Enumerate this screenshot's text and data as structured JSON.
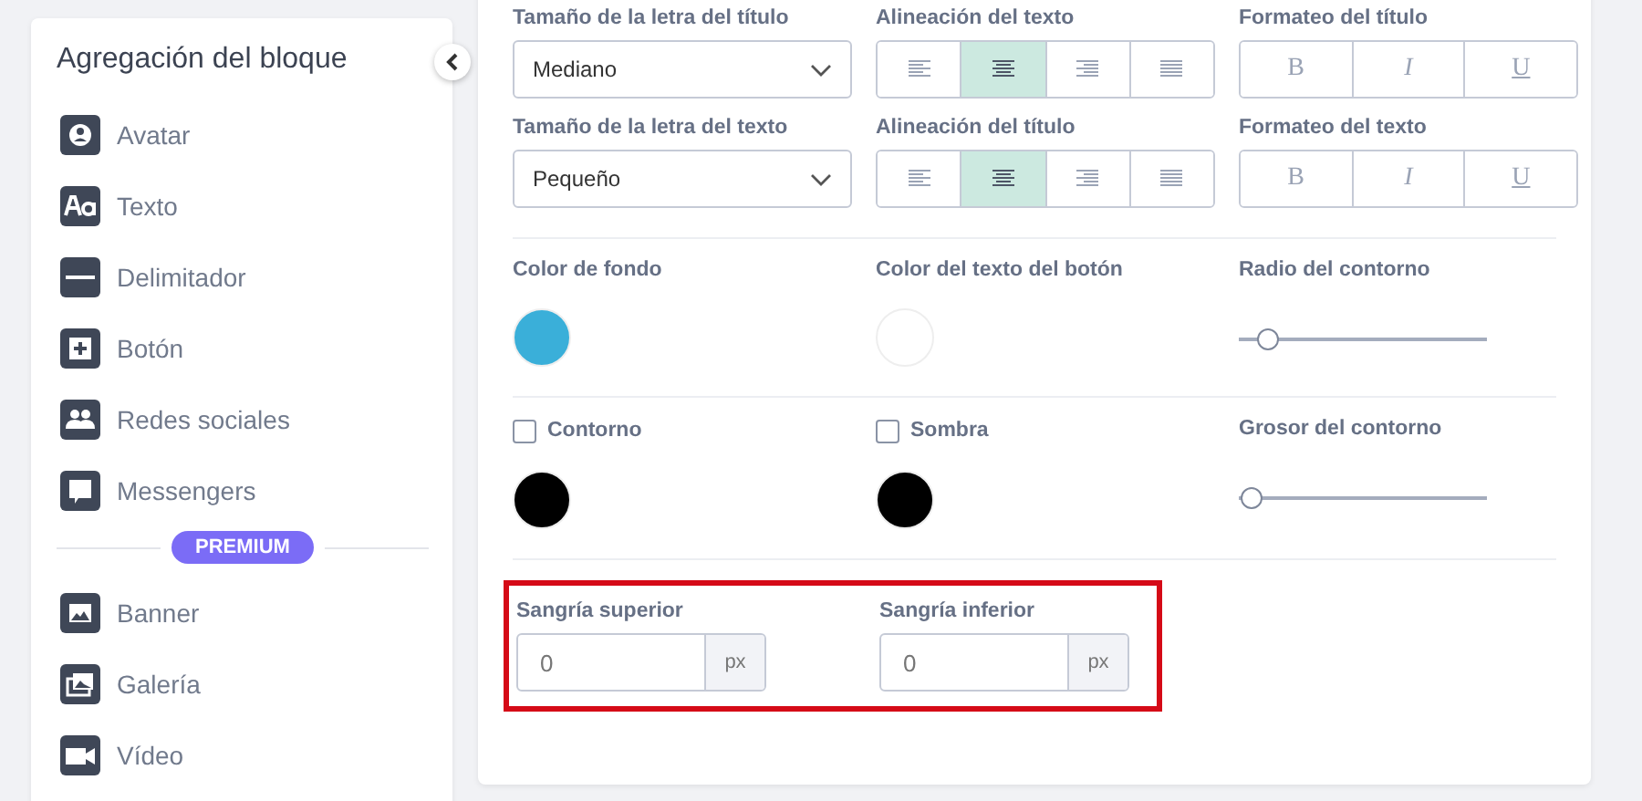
{
  "sidebar": {
    "title": "Agregación del bloque",
    "items": [
      {
        "kind": "avatar",
        "label": "Avatar"
      },
      {
        "kind": "text",
        "label": "Texto"
      },
      {
        "kind": "divider",
        "label": "Delimitador"
      },
      {
        "kind": "button",
        "label": "Botón"
      },
      {
        "kind": "social",
        "label": "Redes sociales"
      },
      {
        "kind": "messenger",
        "label": "Messengers"
      }
    ],
    "premium_badge": "PREMIUM",
    "premium_items": [
      {
        "kind": "banner",
        "label": "Banner"
      },
      {
        "kind": "gallery",
        "label": "Galería"
      },
      {
        "kind": "video",
        "label": "Vídeo"
      }
    ]
  },
  "settings": {
    "font_rows": [
      {
        "size_label": "Tamaño de la letra del título",
        "size_value": "Mediano",
        "align_label": "Alineación del texto",
        "align_options": [
          {
            "kind": "left",
            "selected": false
          },
          {
            "kind": "center",
            "selected": true
          },
          {
            "kind": "right",
            "selected": false
          },
          {
            "kind": "justify",
            "selected": false
          }
        ],
        "format_label": "Formateo del título",
        "format_buttons": [
          {
            "kind": "bold",
            "label": "B"
          },
          {
            "kind": "italic",
            "label": "I"
          },
          {
            "kind": "underline",
            "label": "U"
          }
        ]
      },
      {
        "size_label": "Tamaño de la letra del texto",
        "size_value": "Pequeño",
        "align_label": "Alineación del título",
        "align_options": [
          {
            "kind": "left",
            "selected": false
          },
          {
            "kind": "center",
            "selected": true
          },
          {
            "kind": "right",
            "selected": false
          },
          {
            "kind": "justify",
            "selected": false
          }
        ],
        "format_label": "Formateo del texto",
        "format_buttons": [
          {
            "kind": "bold",
            "label": "B"
          },
          {
            "kind": "italic",
            "label": "I"
          },
          {
            "kind": "underline",
            "label": "U"
          }
        ]
      }
    ],
    "color_row": {
      "colors": [
        {
          "label": "Color de fondo",
          "color": "#3aafd9"
        },
        {
          "label": "Color del texto del botón",
          "color": "#ffffff"
        }
      ],
      "slider": {
        "label": "Radio del contorno",
        "level": 0.11
      }
    },
    "border_row": {
      "toggles": [
        {
          "label": "Contorno",
          "checked": false,
          "color": "#000000"
        },
        {
          "label": "Sombra",
          "checked": false,
          "color": "#000000"
        }
      ],
      "slider": {
        "label": "Grosor del contorno",
        "level": 0.05
      }
    },
    "padding": {
      "highlighted": true,
      "fields": [
        {
          "label": "Sangría superior",
          "value": "0",
          "unit": "px"
        },
        {
          "label": "Sangría inferior",
          "value": "0",
          "unit": "px"
        }
      ]
    }
  }
}
